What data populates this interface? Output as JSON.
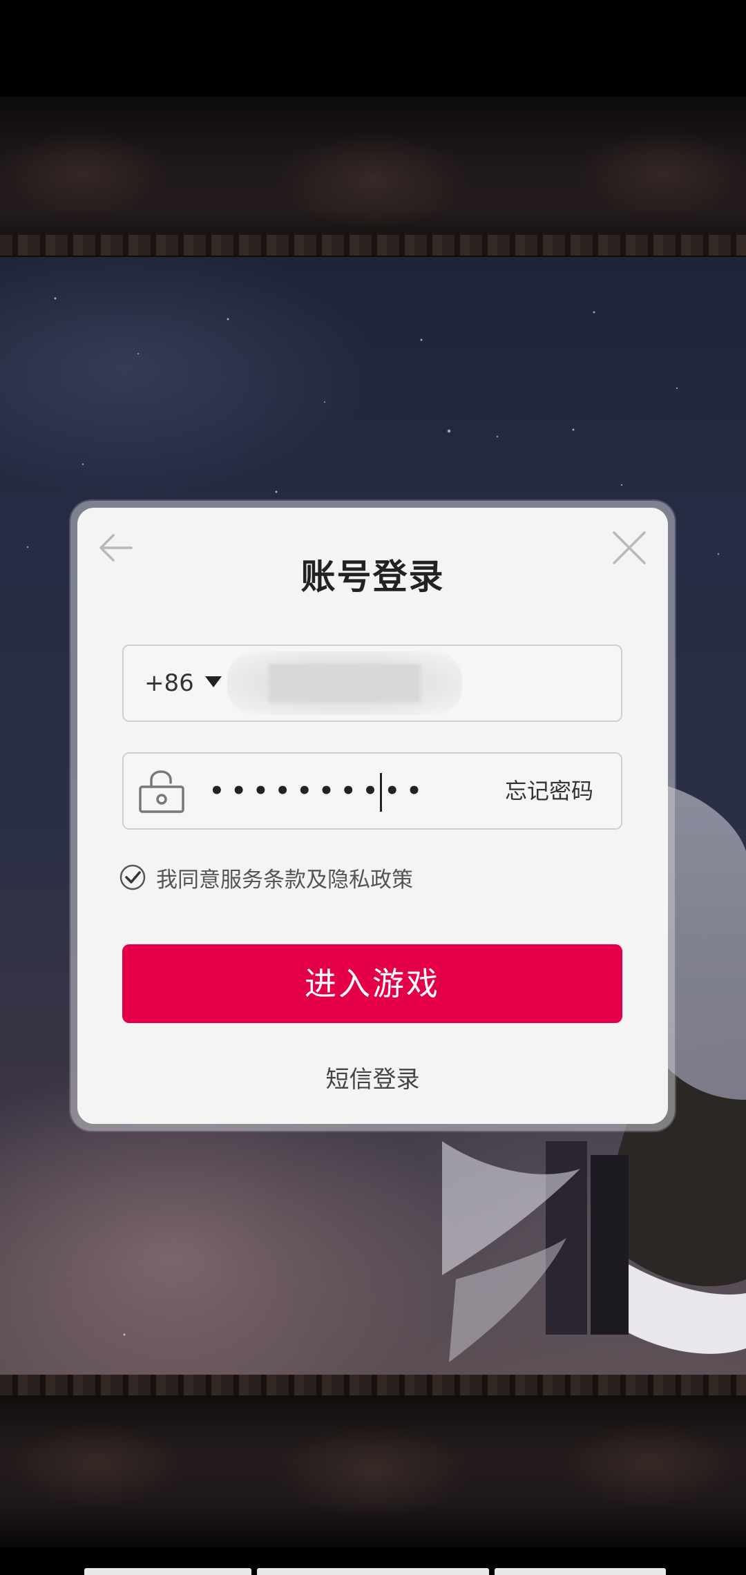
{
  "background": {
    "scene": "starry-night-anime-character",
    "colors": {
      "sky_top": "#1f2438",
      "frame": "#1e1719"
    }
  },
  "dialog": {
    "title": "账号登录",
    "back_icon": "back-arrow-icon",
    "close_icon": "close-icon",
    "phone": {
      "country_code": "+86",
      "dropdown_icon": "caret-down-icon",
      "number": ""
    },
    "password": {
      "lock_icon": "unlock-icon",
      "masked_value": "••••••••••",
      "forgot_label": "忘记密码"
    },
    "agreement": {
      "checked": true,
      "label": "我同意服务条款及隐私政策"
    },
    "primary_button": {
      "label": "进入游戏",
      "color": "#e40049"
    },
    "sms_login_label": "短信登录"
  }
}
